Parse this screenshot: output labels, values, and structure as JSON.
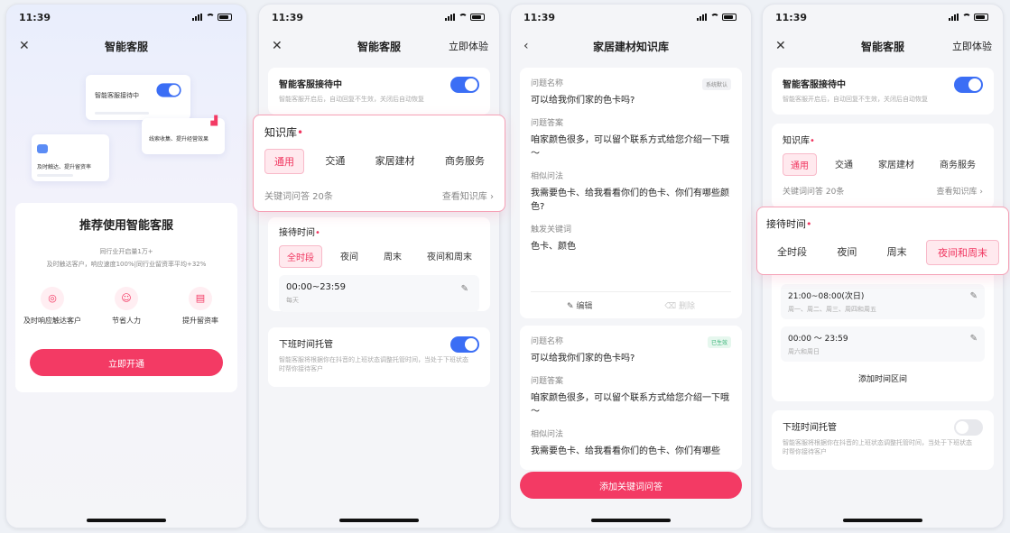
{
  "status_time": "11:39",
  "screen1": {
    "title": "智能客服",
    "preview_card_title": "智能客服接待中",
    "preview_lead": "线索收集、提升经营效果",
    "preview_reach": "及时触达、提升留资率",
    "heading": "推荐使用智能客服",
    "desc_line1": "同行业开启量1万+",
    "desc_line2": "及时触达客户，响应速度100%|同行业留资率平均+32%",
    "features": [
      {
        "label": "及时响应触达客户",
        "icon": "chat-icon"
      },
      {
        "label": "节省人力",
        "icon": "person-icon"
      },
      {
        "label": "提升留资率",
        "icon": "document-icon"
      }
    ],
    "cta": "立即开通"
  },
  "screen2": {
    "title": "智能客服",
    "right": "立即体验",
    "service_title": "智能客服接待中",
    "service_desc": "智能客服开启后，自动回复不生效，关闭后自动恢复",
    "kb_label": "知识库",
    "kb_tabs": [
      "通用",
      "交通",
      "家居建材",
      "商务服务"
    ],
    "kb_count": "关键词问答 20条",
    "kb_link": "查看知识库",
    "time_label": "接待时间",
    "time_tabs": [
      "全时段",
      "夜间",
      "周末",
      "夜间和周末"
    ],
    "time_range": "00:00~23:59",
    "time_days": "每天",
    "offwork_title": "下班时间托管",
    "offwork_desc": "智能客服将根据你在抖音的上班状态调整托管时间，当处于下班状态时帮你接待客户"
  },
  "screen3": {
    "title": "家居建材知识库",
    "qa1": {
      "badge": "系统默认",
      "name_label": "问题名称",
      "name": "可以给我你们家的色卡吗?",
      "answer_label": "问题答案",
      "answer": "咱家颜色很多，可以留个联系方式给您介绍一下哦～",
      "similar_label": "相似问法",
      "similar": "我需要色卡、给我看看你们的色卡、你们有哪些颜色?",
      "keyword_label": "触发关键词",
      "keyword": "色卡、颜色",
      "edit": "编辑",
      "delete": "删除"
    },
    "qa2": {
      "badge": "已生效",
      "name_label": "问题名称",
      "name": "可以给我你们家的色卡吗?",
      "answer_label": "问题答案",
      "answer": "咱家颜色很多，可以留个联系方式给您介绍一下哦～",
      "similar_label": "相似问法",
      "similar": "我需要色卡、给我看看你们的色卡、你们有哪些"
    },
    "cta": "添加关键词问答"
  },
  "screen4": {
    "title": "智能客服",
    "right": "立即体验",
    "service_title": "智能客服接待中",
    "service_desc": "智能客服开启后，自动回复不生效，关闭后自动恢复",
    "kb_label": "知识库",
    "kb_tabs": [
      "通用",
      "交通",
      "家居建材",
      "商务服务"
    ],
    "kb_count": "关键词问答 20条",
    "kb_link": "查看知识库",
    "time_label": "接待时间",
    "time_tabs": [
      "全时段",
      "夜间",
      "周末",
      "夜间和周末"
    ],
    "range1": "21:00~08:00(次日)",
    "range1_days": "周一、周二、周三、周四和周五",
    "range2": "00:00 ～ 23:59",
    "range2_days": "周六和周日",
    "add_range": "添加时间区间",
    "offwork_title": "下班时间托管",
    "offwork_desc": "智能客服将根据你在抖音的上班状态调整托管时间，当处于下班状态时帮你接待客户"
  },
  "colors": {
    "accent": "#f33a64",
    "toggle": "#3b6ef5"
  }
}
